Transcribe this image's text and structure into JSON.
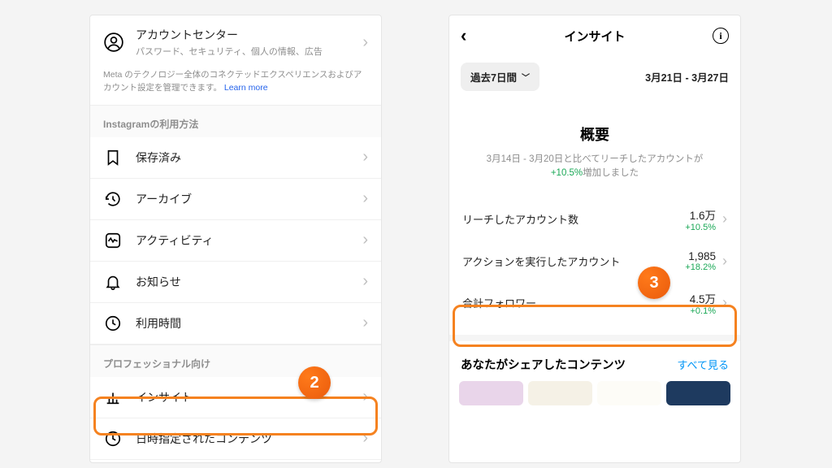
{
  "left": {
    "account_center": {
      "title": "アカウントセンター",
      "subtitle": "パスワード、セキュリティ、個人の情報、広告"
    },
    "meta_note": "Meta のテクノロジー全体のコネクテッドエクスペリエンスおよびアカウント設定を管理できます。",
    "learn_more": "Learn more",
    "section1": "Instagramの利用方法",
    "items1": [
      {
        "label": "保存済み",
        "icon": "bookmark"
      },
      {
        "label": "アーカイブ",
        "icon": "archive"
      },
      {
        "label": "アクティビティ",
        "icon": "activity"
      },
      {
        "label": "お知らせ",
        "icon": "bell"
      },
      {
        "label": "利用時間",
        "icon": "clock"
      }
    ],
    "section2": "プロフェッショナル向け",
    "items2": [
      {
        "label": "インサイト",
        "icon": "insights"
      },
      {
        "label": "日時指定されたコンテンツ",
        "icon": "scheduled"
      }
    ]
  },
  "right": {
    "title": "インサイト",
    "period_label": "過去7日間",
    "date_range": "3月21日 - 3月27日",
    "overview": "概要",
    "overview_sub_prefix": "3月14日 - 3月20日と比べてリーチしたアカウントが",
    "overview_pct": "+10.5%",
    "overview_sub_suffix": "増加しました",
    "stats": [
      {
        "label": "リーチしたアカウント数",
        "value": "1.6万",
        "pct": "+10.5%"
      },
      {
        "label": "アクションを実行したアカウント",
        "value": "1,985",
        "pct": "+18.2%"
      },
      {
        "label": "合計フォロワー",
        "value": "4.5万",
        "pct": "+0.1%"
      }
    ],
    "shared_title": "あなたがシェアしたコンテンツ",
    "see_all": "すべて見る"
  },
  "badges": {
    "b2": "2",
    "b3": "3"
  }
}
